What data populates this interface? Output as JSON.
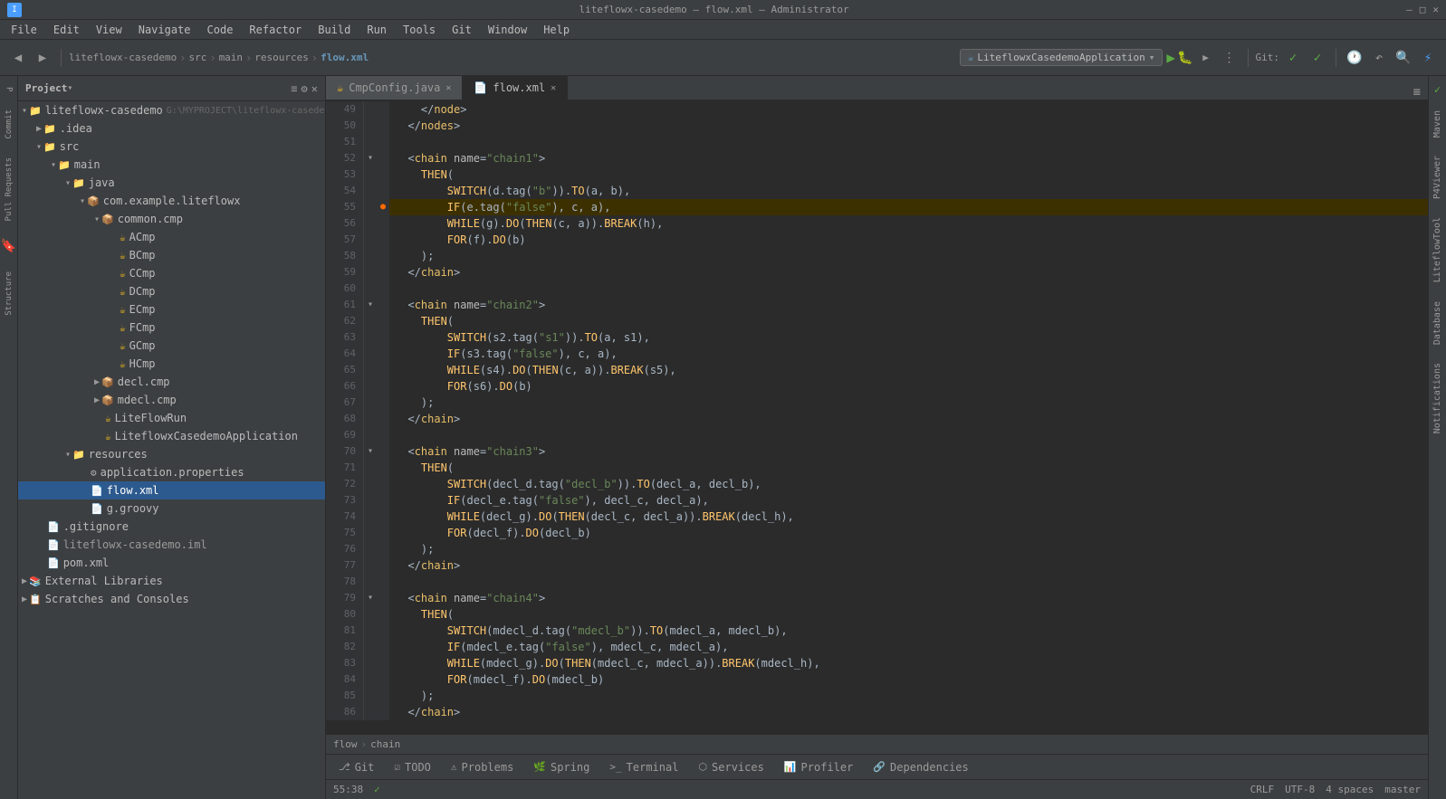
{
  "titlebar": {
    "title": "liteflowx-casedemo – flow.xml – Administrator",
    "min": "–",
    "max": "□",
    "close": "✕"
  },
  "menubar": {
    "items": [
      "File",
      "Edit",
      "View",
      "Navigate",
      "Code",
      "Refactor",
      "Build",
      "Run",
      "Tools",
      "Git",
      "Window",
      "Help"
    ]
  },
  "breadcrumb": {
    "project": "liteflowx-casedemo",
    "src": "src",
    "main": "main",
    "resources": "resources",
    "file": "flow.xml"
  },
  "toolbar": {
    "run_config": "LiteflowxCasedemoApplication",
    "git_label": "Git:"
  },
  "project_panel": {
    "title": "Project",
    "root": "liteflowx-casedemo",
    "root_path": "G:\\MYPROJECT\\liteflowx-casede",
    "tree": [
      {
        "id": 1,
        "indent": 0,
        "label": "liteflowx-casedemo",
        "type": "root",
        "expanded": true
      },
      {
        "id": 2,
        "indent": 1,
        "label": ".idea",
        "type": "folder",
        "expanded": false
      },
      {
        "id": 3,
        "indent": 1,
        "label": "src",
        "type": "folder",
        "expanded": true
      },
      {
        "id": 4,
        "indent": 2,
        "label": "main",
        "type": "folder",
        "expanded": true
      },
      {
        "id": 5,
        "indent": 3,
        "label": "java",
        "type": "folder",
        "expanded": true
      },
      {
        "id": 6,
        "indent": 4,
        "label": "com.example.liteflowx",
        "type": "package",
        "expanded": true
      },
      {
        "id": 7,
        "indent": 5,
        "label": "common.cmp",
        "type": "package",
        "expanded": true
      },
      {
        "id": 8,
        "indent": 6,
        "label": "ACmp",
        "type": "java"
      },
      {
        "id": 9,
        "indent": 6,
        "label": "BCmp",
        "type": "java"
      },
      {
        "id": 10,
        "indent": 6,
        "label": "CCmp",
        "type": "java"
      },
      {
        "id": 11,
        "indent": 6,
        "label": "DCmp",
        "type": "java"
      },
      {
        "id": 12,
        "indent": 6,
        "label": "ECmp",
        "type": "java"
      },
      {
        "id": 13,
        "indent": 6,
        "label": "FCmp",
        "type": "java"
      },
      {
        "id": 14,
        "indent": 6,
        "label": "GCmp",
        "type": "java"
      },
      {
        "id": 15,
        "indent": 6,
        "label": "HCmp",
        "type": "java"
      },
      {
        "id": 16,
        "indent": 5,
        "label": "decl.cmp",
        "type": "package",
        "collapsed": true
      },
      {
        "id": 17,
        "indent": 5,
        "label": "mdecl.cmp",
        "type": "package",
        "collapsed": true
      },
      {
        "id": 18,
        "indent": 5,
        "label": "LiteFlowRun",
        "type": "java"
      },
      {
        "id": 19,
        "indent": 5,
        "label": "LiteflowxCasedemoApplication",
        "type": "java"
      },
      {
        "id": 20,
        "indent": 3,
        "label": "resources",
        "type": "folder",
        "expanded": true
      },
      {
        "id": 21,
        "indent": 4,
        "label": "application.properties",
        "type": "properties"
      },
      {
        "id": 22,
        "indent": 4,
        "label": "flow.xml",
        "type": "xml",
        "selected": true
      },
      {
        "id": 23,
        "indent": 4,
        "label": "g.groovy",
        "type": "groovy"
      },
      {
        "id": 24,
        "indent": 1,
        "label": ".gitignore",
        "type": "text"
      },
      {
        "id": 25,
        "indent": 1,
        "label": "liteflowx-casedemo.iml",
        "type": "iml"
      },
      {
        "id": 26,
        "indent": 1,
        "label": "pom.xml",
        "type": "pom"
      },
      {
        "id": 27,
        "indent": 0,
        "label": "External Libraries",
        "type": "folder",
        "collapsed": true
      },
      {
        "id": 28,
        "indent": 0,
        "label": "Scratches and Consoles",
        "type": "folder",
        "collapsed": true
      }
    ]
  },
  "editor": {
    "tabs": [
      {
        "label": "CmpConfig.java",
        "type": "java",
        "active": false
      },
      {
        "label": "flow.xml",
        "type": "xml",
        "active": true
      }
    ],
    "lines": [
      {
        "num": 49,
        "code": "    </node>",
        "fold": false
      },
      {
        "num": 50,
        "code": "  </nodes>",
        "fold": true
      },
      {
        "num": 51,
        "code": ""
      },
      {
        "num": 52,
        "code": "  <chain name=\"chain1\">",
        "fold": true,
        "foldable": true
      },
      {
        "num": 53,
        "code": "    THEN(",
        "indent": 4
      },
      {
        "num": 54,
        "code": "        SWITCH(d.tag(\"b\")).TO(a, b),",
        "indent": 8
      },
      {
        "num": 55,
        "code": "        IF(e.tag(\"false\"), c, a),",
        "indent": 8,
        "highlighted": true,
        "marker": "warning"
      },
      {
        "num": 56,
        "code": "        WHILE(g).DO(THEN(c, a)).BREAK(h),",
        "indent": 8
      },
      {
        "num": 57,
        "code": "        FOR(f).DO(b)",
        "indent": 8
      },
      {
        "num": 58,
        "code": "    );",
        "indent": 4
      },
      {
        "num": 59,
        "code": "  </chain>",
        "fold": false
      },
      {
        "num": 60,
        "code": ""
      },
      {
        "num": 61,
        "code": "  <chain name=\"chain2\">",
        "fold": true,
        "foldable": true
      },
      {
        "num": 62,
        "code": "    THEN(",
        "indent": 4
      },
      {
        "num": 63,
        "code": "        SWITCH(s2.tag(\"s1\")).TO(a, s1),",
        "indent": 8
      },
      {
        "num": 64,
        "code": "        IF(s3.tag(\"false\"), c, a),",
        "indent": 8
      },
      {
        "num": 65,
        "code": "        WHILE(s4).DO(THEN(c, a)).BREAK(s5),",
        "indent": 8
      },
      {
        "num": 66,
        "code": "        FOR(s6).DO(b)",
        "indent": 8
      },
      {
        "num": 67,
        "code": "    );",
        "indent": 4
      },
      {
        "num": 68,
        "code": "  </chain>"
      },
      {
        "num": 69,
        "code": ""
      },
      {
        "num": 70,
        "code": "  <chain name=\"chain3\">",
        "fold": true,
        "foldable": true
      },
      {
        "num": 71,
        "code": "    THEN(",
        "indent": 4
      },
      {
        "num": 72,
        "code": "        SWITCH(decl_d.tag(\"decl_b\")).TO(decl_a, decl_b),",
        "indent": 8
      },
      {
        "num": 73,
        "code": "        IF(decl_e.tag(\"false\"), decl_c, decl_a),",
        "indent": 8
      },
      {
        "num": 74,
        "code": "        WHILE(decl_g).DO(THEN(decl_c, decl_a)).BREAK(decl_h),",
        "indent": 8
      },
      {
        "num": 75,
        "code": "        FOR(decl_f).DO(decl_b)",
        "indent": 8
      },
      {
        "num": 76,
        "code": "    );",
        "indent": 4
      },
      {
        "num": 77,
        "code": "  </chain>"
      },
      {
        "num": 78,
        "code": ""
      },
      {
        "num": 79,
        "code": "  <chain name=\"chain4\">",
        "fold": true,
        "foldable": true
      },
      {
        "num": 80,
        "code": "    THEN(",
        "indent": 4
      },
      {
        "num": 81,
        "code": "        SWITCH(mdecl_d.tag(\"mdecl_b\")).TO(mdecl_a, mdecl_b),",
        "indent": 8
      },
      {
        "num": 82,
        "code": "        IF(mdecl_e.tag(\"false\"), mdecl_c, mdecl_a),",
        "indent": 8
      },
      {
        "num": 83,
        "code": "        WHILE(mdecl_g).DO(THEN(mdecl_c, mdecl_a)).BREAK(mdecl_h),",
        "indent": 8
      },
      {
        "num": 84,
        "code": "        FOR(mdecl_f).DO(mdecl_b)",
        "indent": 8
      },
      {
        "num": 85,
        "code": "    );",
        "indent": 4
      },
      {
        "num": 86,
        "code": "  </chain>"
      }
    ]
  },
  "footer_breadcrumb": {
    "file": "flow",
    "section": "chain"
  },
  "bottom_tabs": [
    {
      "label": "Git",
      "icon": "⎇",
      "active": false
    },
    {
      "label": "TODO",
      "icon": "☑",
      "active": false
    },
    {
      "label": "Problems",
      "icon": "⚠",
      "active": false
    },
    {
      "label": "Spring",
      "icon": "🌿",
      "active": false
    },
    {
      "label": "Terminal",
      "icon": ">_",
      "active": false
    },
    {
      "label": "Services",
      "icon": "⬡",
      "active": false
    },
    {
      "label": "Profiler",
      "icon": "📊",
      "active": false
    },
    {
      "label": "Dependencies",
      "icon": "🔗",
      "active": false
    }
  ],
  "status_bar": {
    "time": "55:38",
    "encoding": "CRLF",
    "charset": "UTF-8",
    "indent": "4 spaces",
    "branch": "master",
    "line_col": "55:38"
  },
  "right_panels": [
    "Maven",
    "P4Viewer",
    "LiteflowTool",
    "Database",
    "Notifications"
  ],
  "left_panels": [
    "Commit",
    "Pull Requests",
    "Bookmarks",
    "Structure"
  ]
}
